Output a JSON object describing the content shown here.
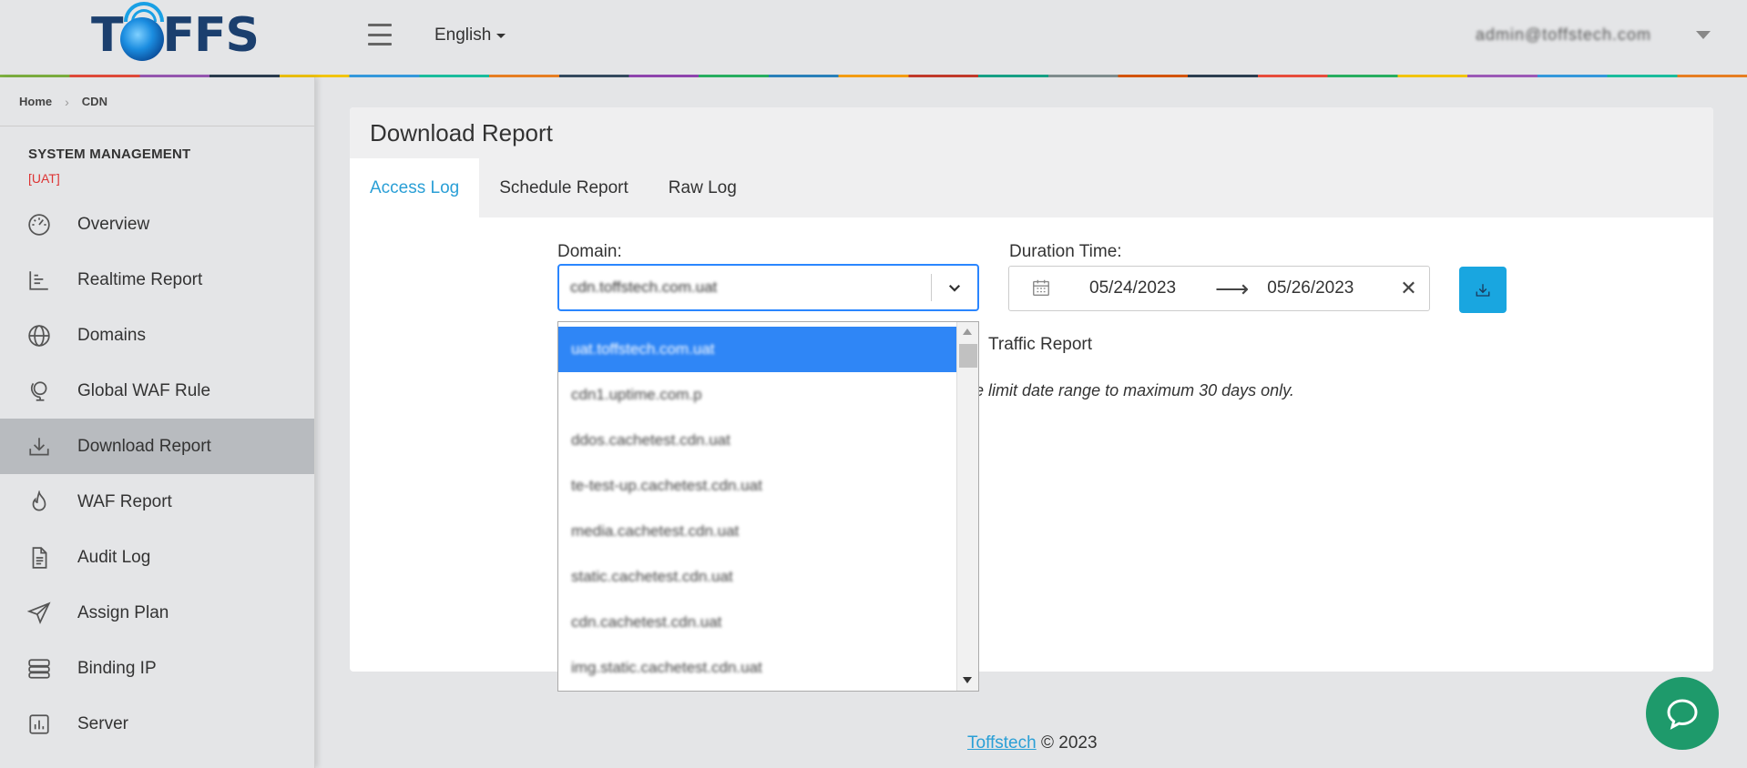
{
  "header": {
    "logo_text_left": "T",
    "logo_text_right": "FFS",
    "language": "English",
    "user_label": "admin@toffstech.com"
  },
  "breadcrumb": {
    "home": "Home",
    "current": "CDN"
  },
  "sidebar": {
    "section_title": "SYSTEM MANAGEMENT",
    "env_tag": "[UAT]",
    "items": [
      {
        "label": "Overview",
        "icon": "dashboard-icon"
      },
      {
        "label": "Realtime Report",
        "icon": "line-chart-icon"
      },
      {
        "label": "Domains",
        "icon": "globe-icon"
      },
      {
        "label": "Global WAF Rule",
        "icon": "globe-stand-icon"
      },
      {
        "label": "Download Report",
        "icon": "download-icon",
        "active": true
      },
      {
        "label": "WAF Report",
        "icon": "fire-icon"
      },
      {
        "label": "Audit Log",
        "icon": "file-icon"
      },
      {
        "label": "Assign Plan",
        "icon": "paper-plane-icon"
      },
      {
        "label": "Binding IP",
        "icon": "server-icon"
      },
      {
        "label": "Server",
        "icon": "bar-chart-icon"
      }
    ]
  },
  "main": {
    "title": "Download Report",
    "tabs": [
      {
        "label": "Access Log",
        "active": true
      },
      {
        "label": "Schedule Report"
      },
      {
        "label": "Raw Log"
      }
    ],
    "domain": {
      "label": "Domain:",
      "value": "cdn.toffstech.com.uat"
    },
    "duration": {
      "label": "Duration Time:",
      "start": "05/24/2023",
      "end": "05/26/2023"
    },
    "traffic_report_label": "Traffic Report",
    "note": "e limit date range to maximum 30 days only.",
    "dropdown_options": [
      "uat.toffstech.com.uat",
      "cdn1.uptime.com.p",
      "ddos.cachetest.cdn.uat",
      "te-test-up.cachetest.cdn.uat",
      "media.cachetest.cdn.uat",
      "static.cachetest.cdn.uat",
      "cdn.cachetest.cdn.uat",
      "img.static.cachetest.cdn.uat"
    ]
  },
  "footer": {
    "company": "Toffstech",
    "copyright": "© 2023"
  },
  "colors": {
    "accent": "#2a9fd6",
    "download_button": "#19a6e0",
    "chat": "#1e9a6b",
    "selected": "#2f86f6",
    "env": "#dd3333"
  }
}
